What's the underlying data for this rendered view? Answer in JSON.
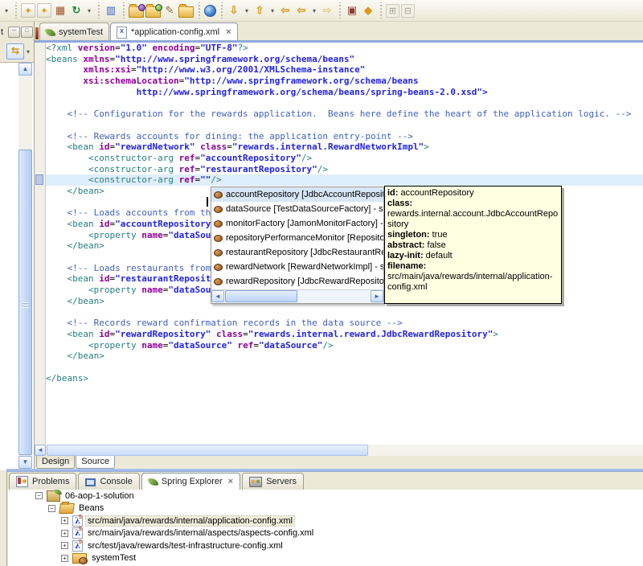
{
  "toolbar": {
    "items": [
      {
        "type": "icon",
        "name": "menu-overflow-chevron-icon",
        "glyph": "▾",
        "style": "plain"
      },
      {
        "type": "sep"
      },
      {
        "type": "icon",
        "name": "new-wizard-icon",
        "glyph": "✦",
        "style": "doc"
      },
      {
        "type": "icon",
        "name": "new-spring-project-icon",
        "glyph": "✦",
        "style": "doc"
      },
      {
        "type": "icon",
        "name": "new-package-icon",
        "glyph": "▦",
        "style": "brick"
      },
      {
        "type": "icon",
        "name": "refresh-icon",
        "glyph": "↻",
        "style": "green"
      },
      {
        "type": "icon",
        "name": "refresh-menu-chevron-icon",
        "glyph": "▾",
        "style": "plain"
      },
      {
        "type": "sep"
      },
      {
        "type": "icon",
        "name": "copy-view-icon",
        "glyph": "▥",
        "style": "blue"
      },
      {
        "type": "sep"
      },
      {
        "type": "icon",
        "name": "open-file-icon",
        "glyph": "",
        "style": "folder folder-purple"
      },
      {
        "type": "icon",
        "name": "open-resource-icon",
        "glyph": "",
        "style": "folder folder-green"
      },
      {
        "type": "icon",
        "name": "edit-pen-icon",
        "glyph": "✎",
        "style": "pen"
      },
      {
        "type": "icon",
        "name": "open-folder-icon",
        "glyph": "",
        "style": "folder"
      },
      {
        "type": "sep"
      },
      {
        "type": "icon",
        "name": "web-browser-icon",
        "glyph": "",
        "style": "globe"
      },
      {
        "type": "sep"
      },
      {
        "type": "icon",
        "name": "import-icon",
        "glyph": "⇩",
        "style": "gold"
      },
      {
        "type": "icon",
        "name": "import-menu-chevron-icon",
        "glyph": "▾",
        "style": "plain"
      },
      {
        "type": "icon",
        "name": "export-icon",
        "glyph": "⇧",
        "style": "gold"
      },
      {
        "type": "icon",
        "name": "export-menu-chevron-icon",
        "glyph": "▾",
        "style": "plain"
      },
      {
        "type": "icon",
        "name": "last-edit-location-icon",
        "glyph": "⇦",
        "style": "gold"
      },
      {
        "type": "icon",
        "name": "back-icon",
        "glyph": "⇦",
        "style": "gold"
      },
      {
        "type": "icon",
        "name": "back-menu-chevron-icon",
        "glyph": "▾",
        "style": "plain"
      },
      {
        "type": "icon",
        "name": "forward-icon",
        "glyph": "⇨",
        "style": "gold-dim"
      },
      {
        "type": "sep"
      },
      {
        "type": "icon",
        "name": "checkin-icon",
        "glyph": "▣",
        "style": "maroon"
      },
      {
        "type": "icon",
        "name": "tag-icon",
        "glyph": "◆",
        "style": "gold"
      },
      {
        "type": "sep"
      },
      {
        "type": "icon",
        "name": "expand-all-icon",
        "glyph": "⊞",
        "style": "dim"
      },
      {
        "type": "icon",
        "name": "collapse-all-icon",
        "glyph": "⊟",
        "style": "dim"
      }
    ]
  },
  "left_panel": {
    "tab_label": "t",
    "minimize_glyph": "─",
    "restore_glyph": "□",
    "link_editor_glyph": "⇆",
    "menu_chevron": "▾",
    "scroll_up_glyph": "▲",
    "scroll_down_glyph": "▼"
  },
  "editor": {
    "tabs": [
      {
        "label": "systemTest",
        "icon": "spring-leaf-icon",
        "active": false
      },
      {
        "label": "*application-config.xml",
        "icon": "xml-file-icon",
        "active": true,
        "close_glyph": "×"
      }
    ],
    "xml_doc_badge": "X",
    "code_lines": [
      "<?xml version=\"1.0\" encoding=\"UTF-8\"?>",
      "<beans xmlns=\"http://www.springframework.org/schema/beans\"",
      "       xmlns:xsi=\"http://www.w3.org/2001/XMLSchema-instance\"",
      "       xsi:schemaLocation=\"http://www.springframework.org/schema/beans",
      "                 http://www.springframework.org/schema/beans/spring-beans-2.0.xsd\">",
      "",
      "    <!-- Configuration for the rewards application.  Beans here define the heart of the application logic. -->",
      "",
      "    <!-- Rewards accounts for dining: the application entry-point -->",
      "    <bean id=\"rewardNetwork\" class=\"rewards.internal.RewardNetworkImpl\">",
      "        <constructor-arg ref=\"accountRepository\"/>",
      "        <constructor-arg ref=\"restaurantRepository\"/>",
      "        <constructor-arg ref=\"\"/>",
      "    </bean>",
      "",
      "    <!-- Loads accounts from the data source -->",
      "    <bean id=\"accountRepository\" class=\"rewards.internal.account.JdbcAccountRepository\">",
      "        <property name=\"dataSource\" ref=\"dataSource\"/>",
      "    </bean>",
      "",
      "    <!-- Loads restaurants from the data source -->",
      "    <bean id=\"restaurantRepository\" class=\"rewards.internal.restaurant.JdbcRestaurantRepository\">",
      "        <property name=\"dataSource\" ref=\"dataSource\"/>",
      "    </bean>",
      "",
      "    <!-- Records reward confirmation records in the data source -->",
      "    <bean id=\"rewardRepository\" class=\"rewards.internal.reward.JdbcRewardRepository\">",
      "        <property name=\"dataSource\" ref=\"dataSource\"/>",
      "    </bean>",
      "",
      "</beans>"
    ],
    "current_line_index": 12,
    "hscroll_left_glyph": "◄",
    "view_tabs": [
      {
        "label": "Design",
        "active": false
      },
      {
        "label": "Source",
        "active": true
      }
    ]
  },
  "completion_popup": {
    "selected_index": 0,
    "items": [
      {
        "label": "accountRepository [JdbcAccountRepository] - src/m"
      },
      {
        "label": "dataSource [TestDataSourceFactory] - src/test/ja"
      },
      {
        "label": "monitorFactory [JamonMonitorFactory] - src/main"
      },
      {
        "label": "repositoryPerformanceMonitor [RepositoryPerform"
      },
      {
        "label": "restaurantRepository [JdbcRestaurantRepository]"
      },
      {
        "label": "rewardNetwork [RewardNetworkImpl] - src/main/j"
      },
      {
        "label": "rewardRepository [JdbcRewardRepository] - src/r"
      }
    ],
    "scroll_left_glyph": "◄",
    "scroll_right_glyph": "►"
  },
  "bean_tooltip": {
    "fields": [
      {
        "label": "id",
        "value": "accountRepository"
      },
      {
        "label": "class",
        "value": "rewards.internal.account.JdbcAccountRepository",
        "block": true
      },
      {
        "label": "singleton",
        "value": "true"
      },
      {
        "label": "abstract",
        "value": "false"
      },
      {
        "label": "lazy-init",
        "value": "default"
      },
      {
        "label": "filename",
        "value": "src/main/java/rewards/internal/application-config.xml"
      }
    ]
  },
  "bottom_panel": {
    "tabs": [
      {
        "label": "Problems",
        "icon": "problems-icon",
        "active": false
      },
      {
        "label": "Console",
        "icon": "console-icon",
        "active": false
      },
      {
        "label": "Spring Explorer",
        "icon": "spring-leaf-icon",
        "active": true,
        "close_glyph": "×"
      },
      {
        "label": "Servers",
        "icon": "servers-icon",
        "active": false
      }
    ],
    "tree": [
      {
        "label": "06-aop-1-solution",
        "level": 0,
        "expander": "−",
        "icon": "spring-project",
        "selected": false
      },
      {
        "label": "Beans",
        "level": 1,
        "expander": "−",
        "icon": "beans-folder",
        "selected": false
      },
      {
        "label": "src/main/java/rewards/internal/application-config.xml",
        "level": 2,
        "expander": "+",
        "icon": "spring-config",
        "selected": true
      },
      {
        "label": "src/main/java/rewards/internal/aspects/aspects-config.xml",
        "level": 2,
        "expander": "+",
        "icon": "spring-config",
        "selected": false
      },
      {
        "label": "src/test/java/rewards/test-infrastructure-config.xml",
        "level": 2,
        "expander": "+",
        "icon": "spring-config",
        "selected": false
      },
      {
        "label": "systemTest",
        "level": 2,
        "expander": "+",
        "icon": "config-set",
        "selected": false
      }
    ]
  },
  "colors": {
    "accent_blue": "#8FA9DC",
    "tooltip_bg": "#FFFFE1",
    "popup_selection": "#D8E6F8",
    "current_line": "#DFEEFB",
    "tag_teal": "#267F7F",
    "attr_purple": "#90009A",
    "value_blue": "#2222E6",
    "comment_blue": "#3F5FBF"
  }
}
